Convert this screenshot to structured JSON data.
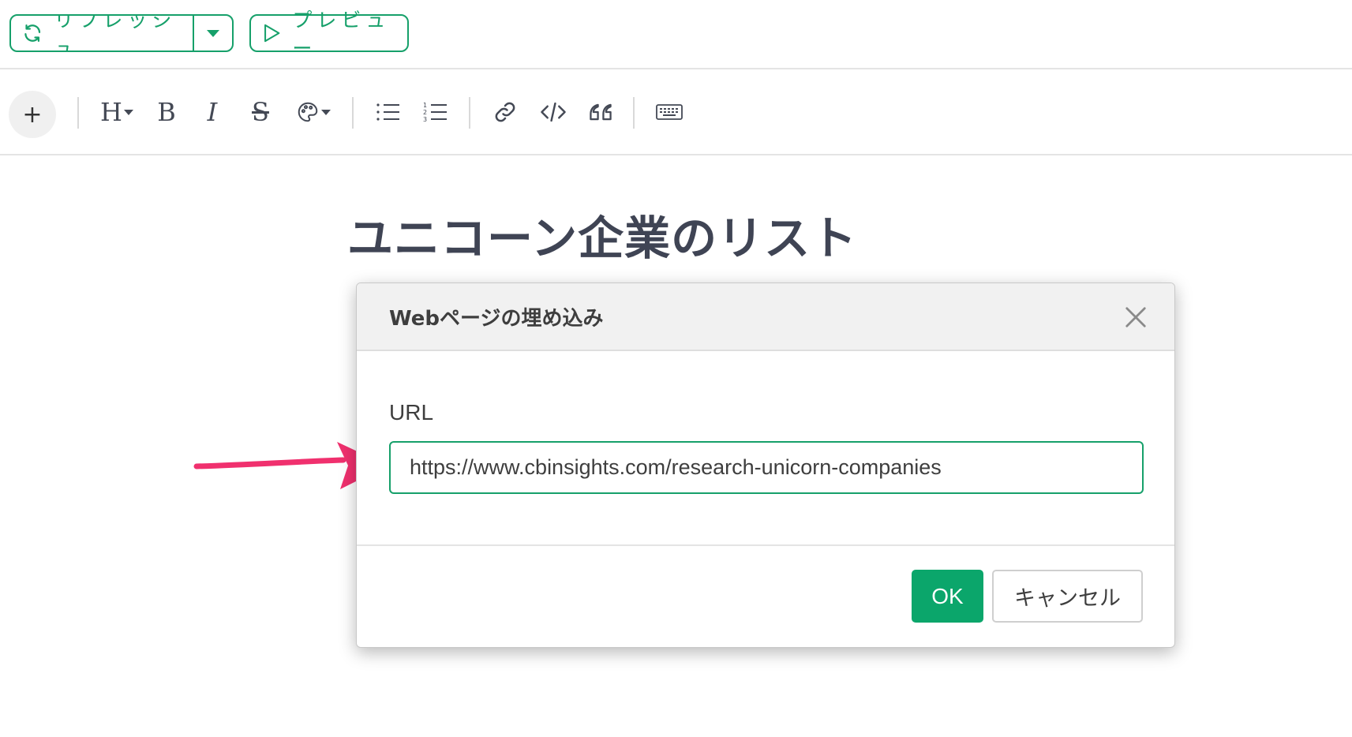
{
  "topbar": {
    "refresh_label": "リフレッシュ",
    "preview_label": "プレビュー",
    "accent_color": "#16a06a"
  },
  "toolbar": {
    "add_label": "+",
    "heading_label": "H",
    "bold_label": "B",
    "italic_label": "I",
    "strike_label": "S",
    "icons": [
      "plus-icon",
      "heading-icon",
      "bold-icon",
      "italic-icon",
      "strikethrough-icon",
      "palette-icon",
      "bullet-list-icon",
      "numbered-list-icon",
      "link-icon",
      "code-icon",
      "quote-icon",
      "keyboard-icon"
    ]
  },
  "document": {
    "title": "ユニコーン企業のリスト"
  },
  "modal": {
    "title": "Webページの埋め込み",
    "url_label": "URL",
    "url_value": "https://www.cbinsights.com/research-unicorn-companies",
    "ok_label": "OK",
    "cancel_label": "キャンセル",
    "ok_color": "#0ba66b"
  },
  "annotation": {
    "arrow_color": "#f0306e"
  }
}
